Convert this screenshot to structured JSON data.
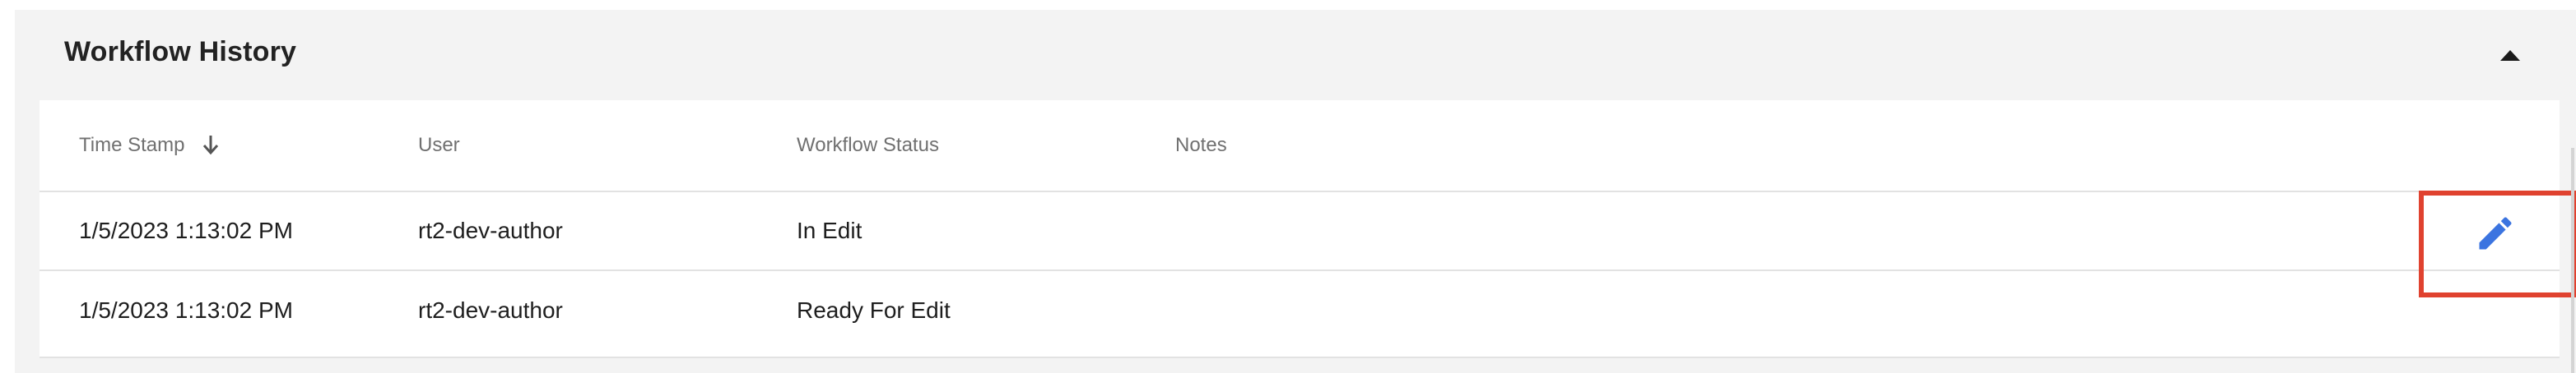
{
  "panel": {
    "title": "Workflow History",
    "collapse_icon": "caret-up-icon"
  },
  "table": {
    "columns": [
      {
        "label": "Time Stamp",
        "sort": "descending",
        "sort_icon": "arrow-down-icon"
      },
      {
        "label": "User"
      },
      {
        "label": "Workflow Status"
      },
      {
        "label": "Notes"
      }
    ],
    "rows": [
      {
        "timestamp": "1/5/2023 1:13:02 PM",
        "user": "rt2-dev-author",
        "status": "In Edit",
        "notes": ""
      },
      {
        "timestamp": "1/5/2023 1:13:02 PM",
        "user": "rt2-dev-author",
        "status": "Ready For Edit",
        "notes": ""
      }
    ],
    "row_action_icon": "pencil-edit-icon"
  },
  "colors": {
    "panel_bg": "#f3f3f3",
    "edit_icon": "#3b74e0",
    "highlight": "#e0422f"
  }
}
